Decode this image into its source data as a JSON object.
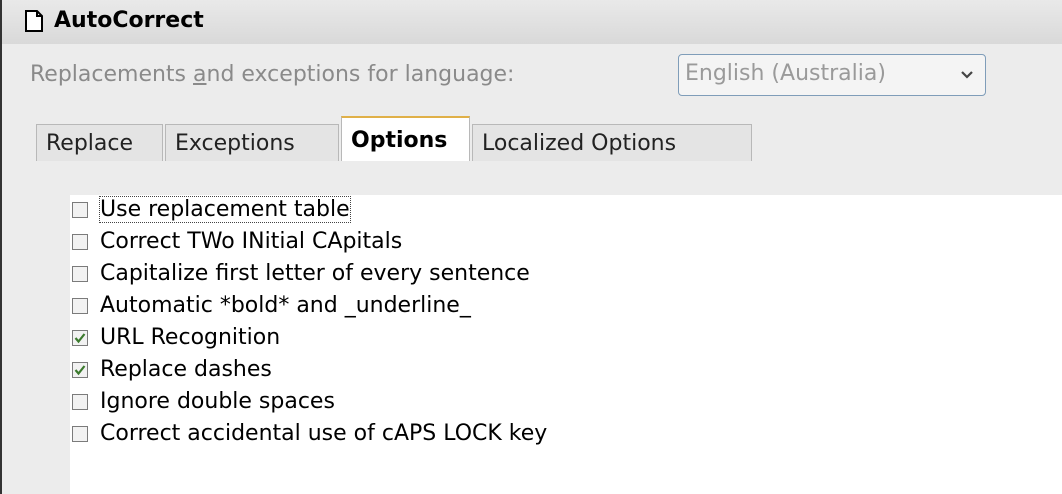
{
  "dialog": {
    "title": "AutoCorrect",
    "icon": "document-icon"
  },
  "language": {
    "label_pre": "Replacements ",
    "label_accel": "a",
    "label_post": "nd exceptions for language:",
    "selected": "English (Australia)"
  },
  "tabs": [
    {
      "label": "Replace",
      "active": false
    },
    {
      "label": "Exceptions",
      "active": false
    },
    {
      "label": "Options",
      "active": true
    },
    {
      "label": "Localized Options",
      "active": false
    }
  ],
  "options": [
    {
      "label": "Use replacement table",
      "checked": false
    },
    {
      "label": "Correct TWo INitial CApitals",
      "checked": false
    },
    {
      "label": "Capitalize first letter of every sentence",
      "checked": false
    },
    {
      "label": "Automatic *bold* and _underline_",
      "checked": false
    },
    {
      "label": "URL Recognition",
      "checked": true
    },
    {
      "label": "Replace dashes",
      "checked": true
    },
    {
      "label": "Ignore double spaces",
      "checked": false
    },
    {
      "label": "Correct accidental use of cAPS LOCK key",
      "checked": false
    }
  ],
  "colors": {
    "check": "#3c7a2e",
    "active_tab_accent": "#e0b048"
  }
}
